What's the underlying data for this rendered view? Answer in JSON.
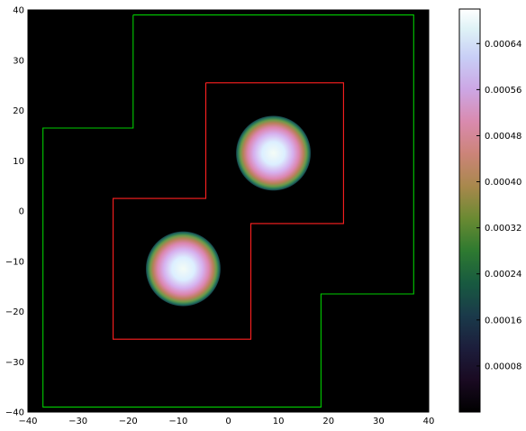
{
  "chart_data": {
    "type": "heatmap",
    "title": "",
    "xlabel": "",
    "ylabel": "",
    "xlim": [
      -40,
      40
    ],
    "ylim": [
      -40,
      40
    ],
    "x_ticks": [
      -40,
      -30,
      -20,
      -10,
      0,
      10,
      20,
      30,
      40
    ],
    "y_ticks": [
      -40,
      -30,
      -20,
      -10,
      0,
      10,
      20,
      30,
      40
    ],
    "background_color": "#000000",
    "colormap": "cubehelix",
    "blobs": [
      {
        "cx": 9,
        "cy": 11.5,
        "radius": 7.5,
        "peak": 0.00068
      },
      {
        "cx": -9,
        "cy": -11.5,
        "radius": 7.5,
        "peak": 0.00068
      }
    ],
    "contours": [
      {
        "color": "#00cc00",
        "points": [
          [
            -19,
            39
          ],
          [
            37,
            39
          ],
          [
            37,
            -16.5
          ],
          [
            18.5,
            -16.5
          ],
          [
            18.5,
            -39
          ],
          [
            -37,
            -39
          ],
          [
            -37,
            16.5
          ],
          [
            -19,
            16.5
          ],
          [
            -19,
            39
          ]
        ]
      },
      {
        "color": "#ff2020",
        "points": [
          [
            -4.5,
            25.5
          ],
          [
            23,
            25.5
          ],
          [
            23,
            -2.5
          ],
          [
            4.5,
            -2.5
          ],
          [
            4.5,
            -25.5
          ],
          [
            -23,
            -25.5
          ],
          [
            -23,
            2.5
          ],
          [
            -4.5,
            2.5
          ],
          [
            -4.5,
            25.5
          ]
        ]
      }
    ],
    "colorbar": {
      "vmin": 0,
      "vmax": 0.0007,
      "ticks": [
        "0.00008",
        "0.00016",
        "0.00024",
        "0.00032",
        "0.00040",
        "0.00048",
        "0.00056",
        "0.00064"
      ],
      "tick_values": [
        8e-05,
        0.00016,
        0.00024,
        0.00032,
        0.0004,
        0.00048,
        0.00056,
        0.00064
      ]
    }
  }
}
